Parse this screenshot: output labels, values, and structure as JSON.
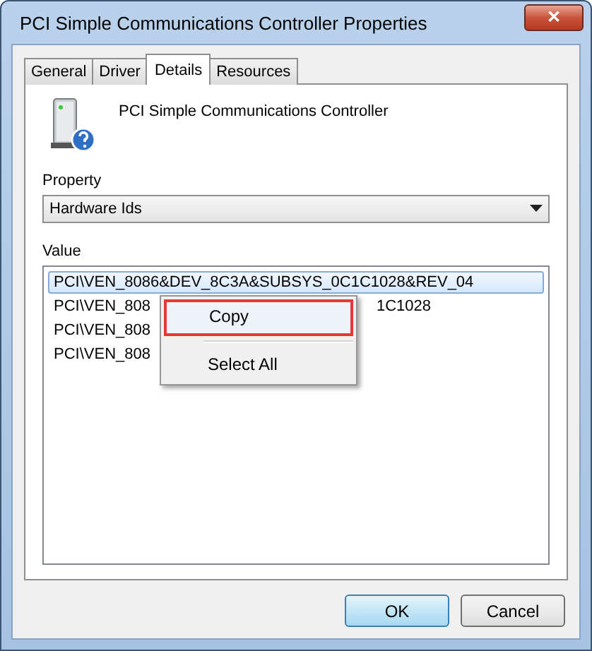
{
  "window": {
    "title": "PCI Simple Communications Controller Properties",
    "close": "✕"
  },
  "tabs": [
    {
      "label": "General",
      "selected": false
    },
    {
      "label": "Driver",
      "selected": false
    },
    {
      "label": "Details",
      "selected": true
    },
    {
      "label": "Resources",
      "selected": false
    }
  ],
  "device_name": "PCI Simple Communications Controller",
  "property": {
    "label": "Property",
    "value": "Hardware Ids"
  },
  "value": {
    "label": "Value",
    "rows": [
      {
        "parts": [
          "PCI\\VEN_8086&DEV_8C3A&SUBSYS_0C1C1028&REV_04"
        ],
        "selected": true
      },
      {
        "parts": [
          "PCI\\VEN_808",
          "1C1028"
        ],
        "selected": false
      },
      {
        "parts": [
          "PCI\\VEN_808"
        ],
        "selected": false
      },
      {
        "parts": [
          "PCI\\VEN_808"
        ],
        "selected": false
      }
    ]
  },
  "context_menu": [
    {
      "label": "Copy",
      "highlighted": true
    },
    {
      "label": "Select All",
      "highlighted": false
    }
  ],
  "buttons": [
    {
      "label": "OK",
      "default": true
    },
    {
      "label": "Cancel",
      "default": false
    }
  ]
}
